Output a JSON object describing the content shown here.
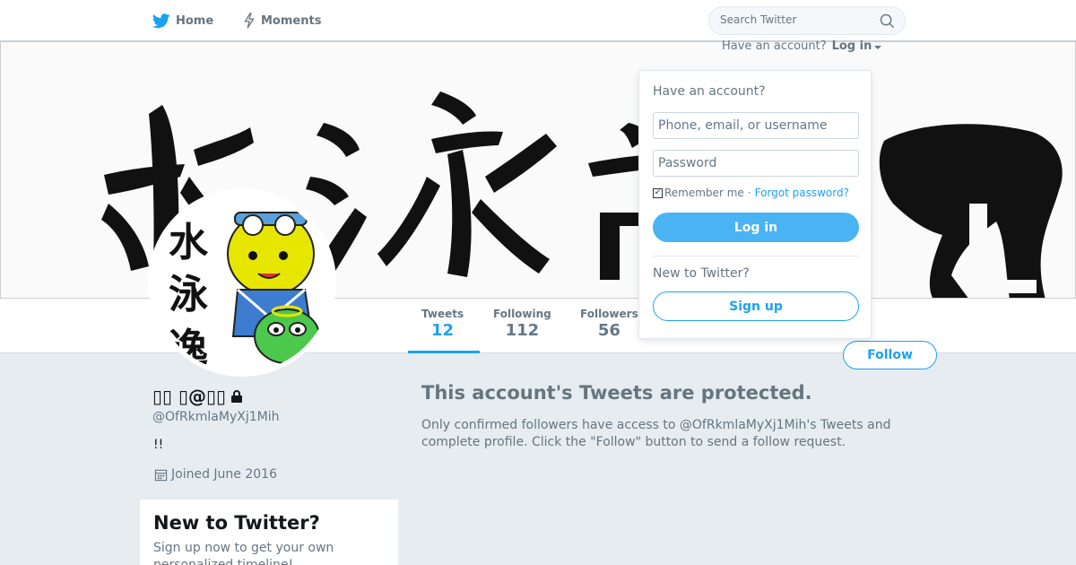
{
  "nav": {
    "home_label": "Home",
    "moments_label": "Moments",
    "search_placeholder": "Search Twitter"
  },
  "login_prompt": {
    "have_account": "Have an account?",
    "login_label": "Log in"
  },
  "login_dropdown": {
    "title": "Have an account?",
    "username_placeholder": "Phone, email, or username",
    "password_placeholder": "Password",
    "remember_label": "Remember me",
    "separator": "·",
    "forgot_label": "Forgot password?",
    "login_button": "Log in",
    "new_to_twitter": "New to Twitter?",
    "signup_button": "Sign up"
  },
  "banner": {
    "text": "水泳部"
  },
  "stats": [
    {
      "label": "Tweets",
      "value": "12"
    },
    {
      "label": "Following",
      "value": "112"
    },
    {
      "label": "Followers",
      "value": "56"
    }
  ],
  "follow_button": "Follow",
  "profile": {
    "name": "▯▯ ▯@▯▯",
    "handle": "@OfRkmlaMyXj1Mih",
    "bio": "!!",
    "joined": "Joined June 2016",
    "avatar_text": [
      "水",
      "泳",
      "逸"
    ]
  },
  "new_box": {
    "title": "New to Twitter?",
    "text": "Sign up now to get your own personalized timeline!"
  },
  "protected": {
    "title": "This account's Tweets are protected.",
    "text": "Only confirmed followers have access to @OfRkmlaMyXj1Mih's Tweets and complete profile. Click the \"Follow\" button to send a follow request."
  },
  "colors": {
    "brand": "#1da1f2",
    "login_button": "#4ab3f4",
    "page_bg": "#e6ecf0"
  }
}
